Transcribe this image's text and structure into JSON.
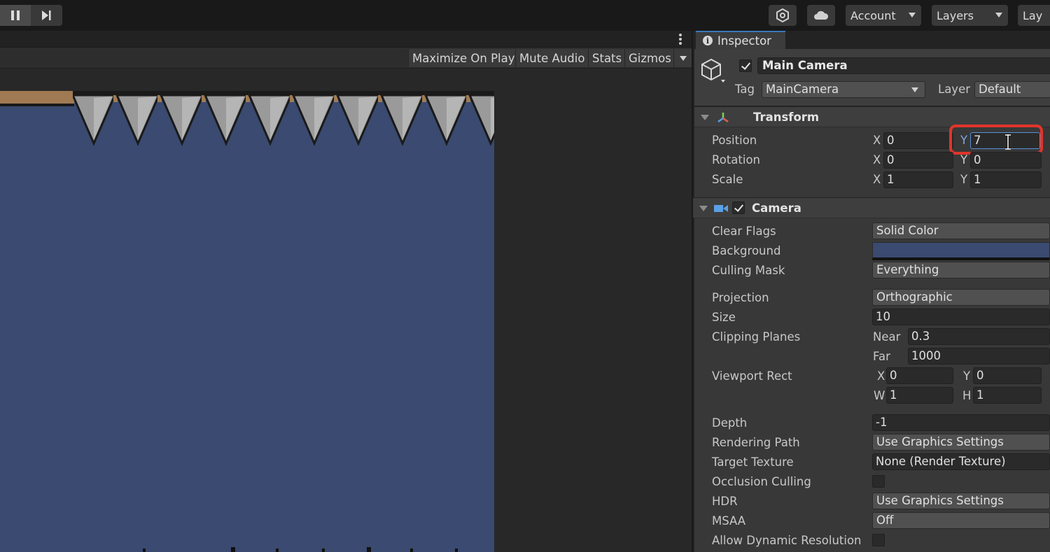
{
  "toolbar": {
    "account_label": "Account",
    "layers_label": "Layers",
    "layout_label": "Lay"
  },
  "game_view": {
    "buttons": {
      "maximize_on_play": "Maximize On Play",
      "mute_audio": "Mute Audio",
      "stats": "Stats",
      "gizmos": "Gizmos"
    },
    "background_color": "#3a4a70"
  },
  "inspector": {
    "tab_label": "Inspector",
    "object": {
      "name": "Main Camera",
      "active": true,
      "tag_label": "Tag",
      "tag_value": "MainCamera",
      "layer_label": "Layer",
      "layer_value": "Default"
    },
    "transform": {
      "title": "Transform",
      "position_label": "Position",
      "rotation_label": "Rotation",
      "scale_label": "Scale",
      "position": {
        "x": "0",
        "y": "7"
      },
      "rotation": {
        "x": "0",
        "y": "0"
      },
      "scale": {
        "x": "1",
        "y": "1"
      },
      "axis_x": "X",
      "axis_y": "Y"
    },
    "camera": {
      "title": "Camera",
      "enabled": true,
      "clear_flags_label": "Clear Flags",
      "clear_flags_value": "Solid Color",
      "background_label": "Background",
      "background_color": "#3a4a70",
      "culling_mask_label": "Culling Mask",
      "culling_mask_value": "Everything",
      "projection_label": "Projection",
      "projection_value": "Orthographic",
      "size_label": "Size",
      "size_value": "10",
      "clipping_planes_label": "Clipping Planes",
      "near_label": "Near",
      "near_value": "0.3",
      "far_label": "Far",
      "far_value": "1000",
      "viewport_rect_label": "Viewport Rect",
      "viewport": {
        "x_label": "X",
        "x": "0",
        "y_label": "Y",
        "y": "0",
        "w_label": "W",
        "w": "1",
        "h_label": "H",
        "h": "1"
      },
      "depth_label": "Depth",
      "depth_value": "-1",
      "rendering_path_label": "Rendering Path",
      "rendering_path_value": "Use Graphics Settings",
      "target_texture_label": "Target Texture",
      "target_texture_value": "None (Render Texture)",
      "occlusion_culling_label": "Occlusion Culling",
      "occlusion_culling": false,
      "hdr_label": "HDR",
      "hdr_value": "Use Graphics Settings",
      "msaa_label": "MSAA",
      "msaa_value": "Off",
      "allow_dynamic_resolution_label": "Allow Dynamic Resolution",
      "allow_dynamic_resolution": false
    }
  }
}
